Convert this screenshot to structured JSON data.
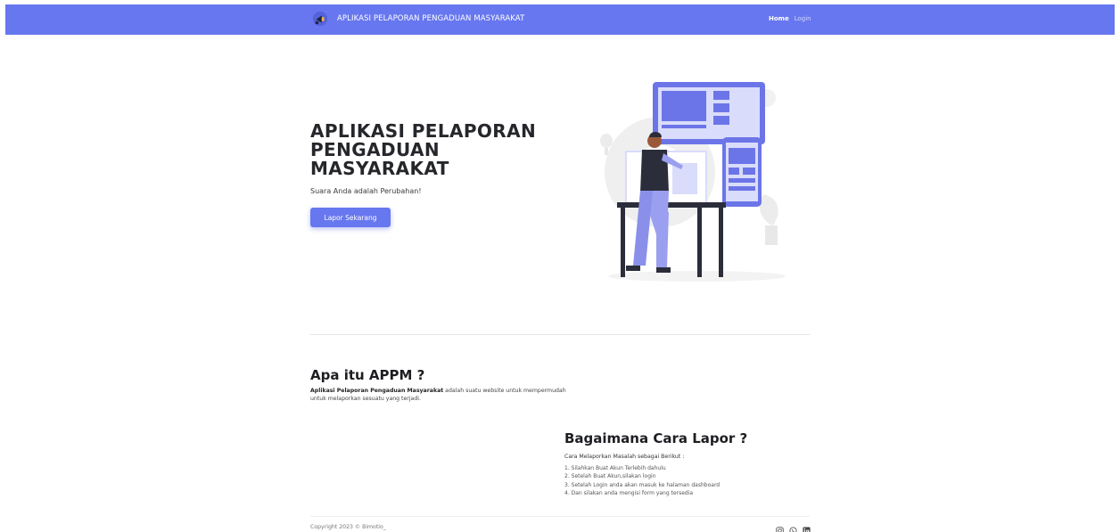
{
  "navbar": {
    "brand": "APLIKASI PELAPORAN PENGADUAN MASYARAKAT",
    "logo_icon": "megaphone-icon",
    "links": [
      {
        "label": "Home",
        "active": true
      },
      {
        "label": "Login",
        "active": false
      }
    ],
    "color": "#6777ef"
  },
  "hero": {
    "title_lines": [
      "APLIKASI PELAPORAN",
      "PENGADUAN",
      "MASYARAKAT"
    ],
    "subtitle": "Suara Anda adalah Perubahan!",
    "button_label": "Lapor Sekarang",
    "illustration": "person-designing-ui-illustration"
  },
  "about": {
    "title": "Apa itu APPM ?",
    "desc_bold": "Aplikasi Pelaporan Pengaduan Masyarakat",
    "desc_rest_1": " adalah suatu website untuk mempermudah",
    "desc_rest_2": "untuk melaporkan sesuatu yang terjadi."
  },
  "howto": {
    "title": "Bagaimana Cara Lapor ?",
    "intro": "Cara Melaporkan Masalah sebagai Berikut :",
    "steps": [
      "1. Silahkan Buat Akun Terlebih dahulu",
      "2. Setelah Buat Akun,silakan login",
      "3. Setelah Login anda akan masuk ke halaman dashboard",
      "4. Dan silakan anda mengisi form yang tersedia"
    ]
  },
  "footer": {
    "copyright": "Copyright 2023 © Bimotio_",
    "social_icons": [
      "instagram-icon",
      "whatsapp-icon",
      "linkedin-icon"
    ]
  }
}
